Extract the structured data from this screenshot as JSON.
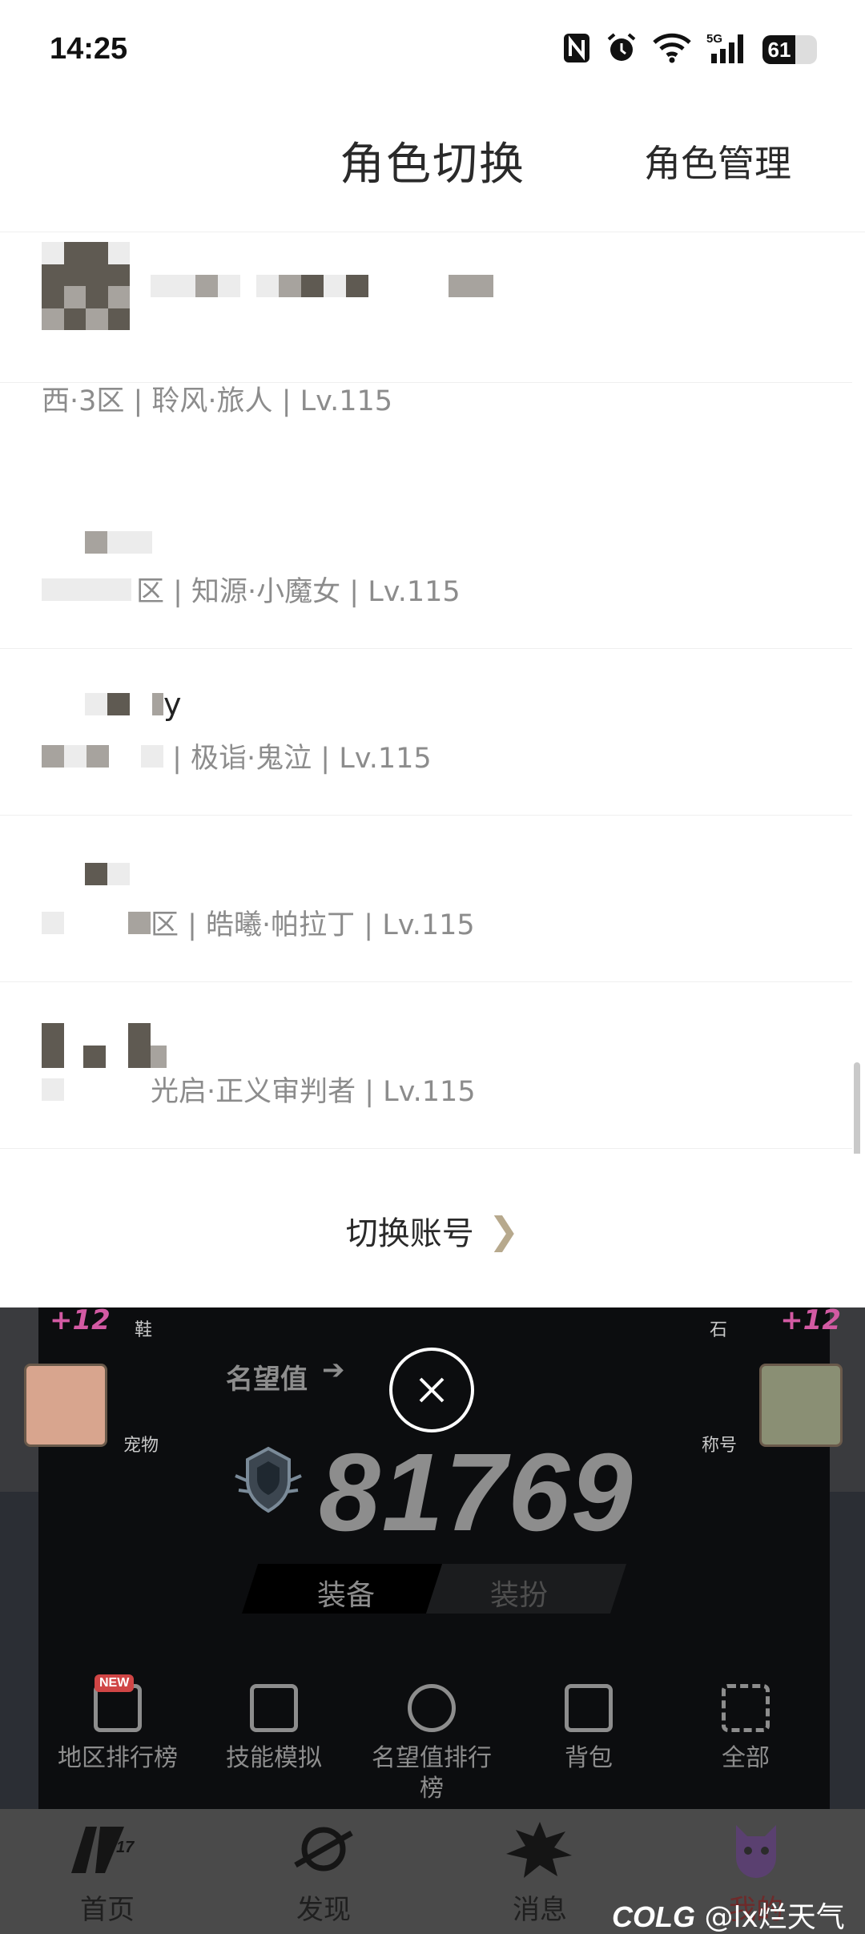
{
  "status_bar": {
    "time": "14:25",
    "network": "5G",
    "battery": "61",
    "battery_level": 0.61,
    "icons": [
      "nfc-icon",
      "alarm-icon",
      "wifi-icon",
      "signal-icon",
      "battery-icon"
    ]
  },
  "header": {
    "title": "角色切换",
    "manage": "角色管理"
  },
  "characters": [
    {
      "name": "",
      "sub": "西·3区 | 聆风·旅人 | Lv.115"
    },
    {
      "name": "",
      "sub": "区 | 知源·小魔女 | Lv.115"
    },
    {
      "name": "y",
      "sub": " | 极诣·鬼泣 | Lv.115"
    },
    {
      "name": "",
      "sub": "区 | 皓曦·帕拉丁 | Lv.115"
    },
    {
      "name": "",
      "sub": "光启·正义审判者 | Lv.115"
    }
  ],
  "switch_account": "切换账号",
  "background": {
    "slot_shoes": "鞋",
    "slot_pet": "宠物",
    "slot_stone": "石",
    "slot_title": "称号",
    "plus_left": "+12",
    "plus_right": "+12",
    "fame_label": "名望值",
    "fame_value": "81769",
    "seg_equip": "装备",
    "seg_outfit": "装扮",
    "new_badge": "NEW",
    "quick": [
      {
        "label": "地区排行榜",
        "icon": "ranking-icon"
      },
      {
        "label": "技能模拟",
        "icon": "skill-icon"
      },
      {
        "label": "名望值排行榜",
        "icon": "fame-rank-icon"
      },
      {
        "label": "背包",
        "icon": "bag-icon"
      },
      {
        "label": "全部",
        "icon": "grid-icon"
      }
    ]
  },
  "tabs": [
    {
      "label": "首页",
      "icon": "home-logo-icon"
    },
    {
      "label": "发现",
      "icon": "discover-icon"
    },
    {
      "label": "消息",
      "icon": "message-icon"
    },
    {
      "label": "我的",
      "icon": "profile-icon"
    }
  ],
  "watermark": {
    "brand": "COLG",
    "user": "@lx烂天气"
  }
}
